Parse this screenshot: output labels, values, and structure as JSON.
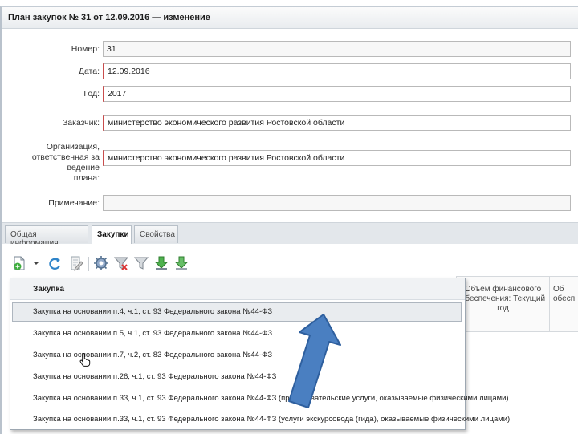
{
  "window": {
    "title": "План закупок № 31 от 12.09.2016 — изменение"
  },
  "form": {
    "number": {
      "label": "Номер:",
      "value": "31"
    },
    "date": {
      "label": "Дата:",
      "value": "12.09.2016"
    },
    "year": {
      "label": "Год:",
      "value": "2017"
    },
    "customer": {
      "label": "Заказчик:",
      "value": "министерство экономического развития Ростовской области"
    },
    "org": {
      "label_line1": "Организация,",
      "label_line2": "ответственная за ведение",
      "label_line3": "плана:",
      "value": "министерство экономического развития Ростовской области"
    },
    "note": {
      "label": "Примечание:",
      "value": ""
    }
  },
  "tabs": [
    {
      "label": "Общая информация"
    },
    {
      "label": "Закупки"
    },
    {
      "label": "Свойства"
    }
  ],
  "toolbar": {
    "icons": [
      "add-document-icon",
      "refresh-icon",
      "edit-icon",
      "settings-icon",
      "filter-clear-icon",
      "filter-icon",
      "download-icon",
      "import-icon"
    ]
  },
  "grid": {
    "columns": [
      {
        "label_line1": "Объем финансового",
        "label_line2": "обеспечения: Текущий",
        "label_line3": "год"
      },
      {
        "label_line1": "Об",
        "label_line2": "обесп"
      }
    ]
  },
  "dropdown": {
    "header": "Закупка",
    "items": [
      "Закупка на основании п.4, ч.1, ст. 93 Федерального закона №44-ФЗ",
      "Закупка на основании п.5, ч.1, ст. 93 Федерального закона №44-ФЗ",
      "Закупка на основании п.7, ч.2, ст. 83 Федерального закона №44-ФЗ",
      "Закупка на основании п.26, ч.1, ст. 93 Федерального закона №44-ФЗ",
      "Закупка на основании п.33, ч.1, ст. 93 Федерального закона №44-ФЗ (преподавательские услуги, оказываемые физическими лицами)",
      "Закупка на основании п.33, ч.1, ст. 93 Федерального закона №44-ФЗ (услуги экскурсовода (гида), оказываемые физическими лицами)"
    ]
  },
  "colors": {
    "accent_arrow": "#4a7fc1",
    "required_border": "#c94c4c"
  }
}
